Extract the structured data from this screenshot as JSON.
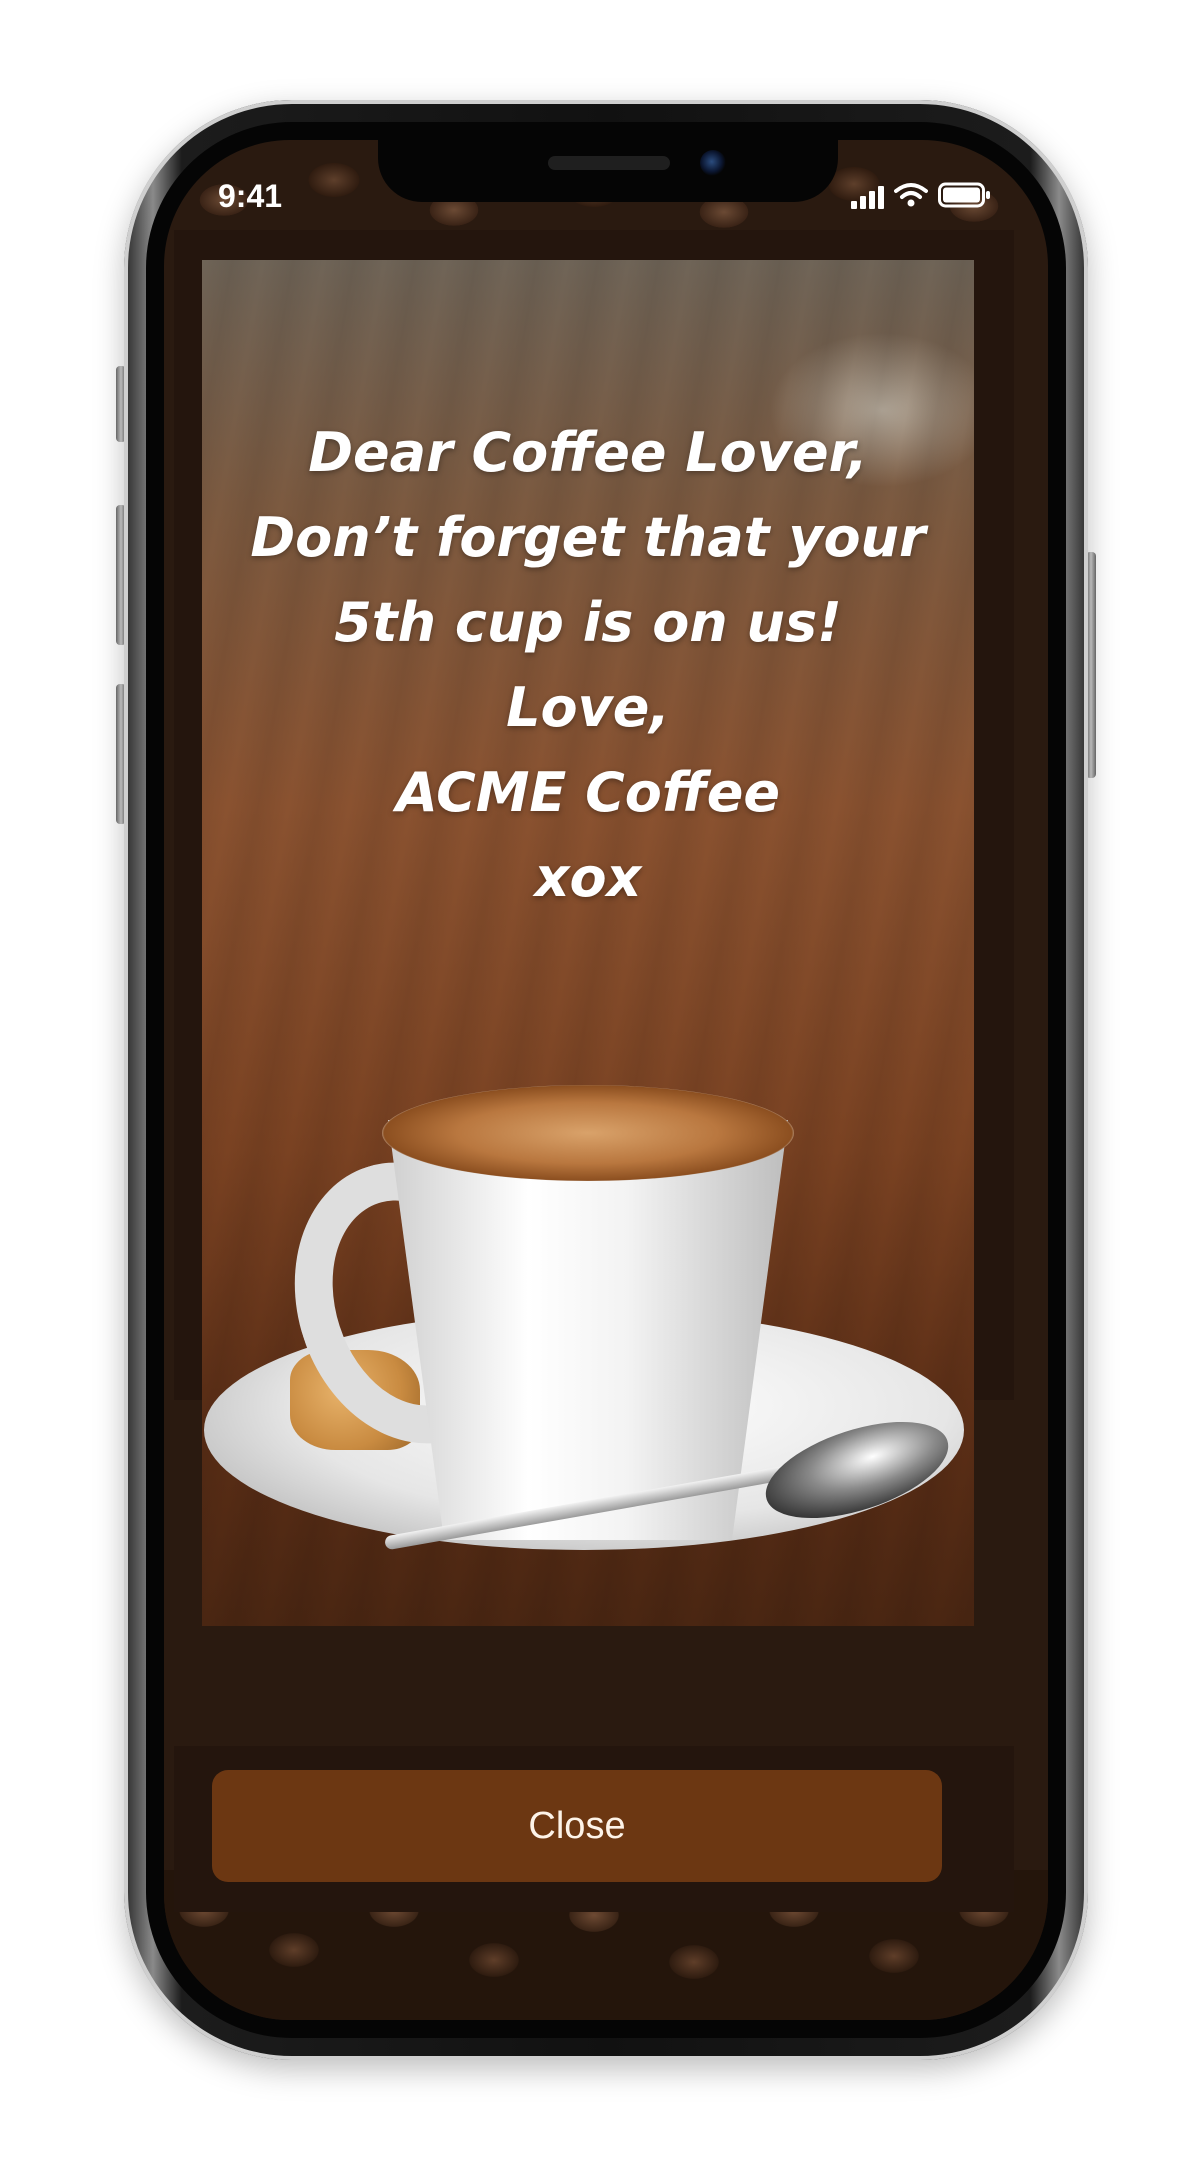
{
  "status_bar": {
    "time": "9:41",
    "icons": [
      "cellular-signal-icon",
      "wifi-icon",
      "battery-icon"
    ]
  },
  "notification": {
    "message_lines": [
      "Dear Coffee Lover,",
      "Don’t forget that your",
      "5th cup is on us!",
      "Love,",
      "ACME Coffee",
      "xox"
    ],
    "image": "coffee-cup-on-saucer-photo",
    "close_label": "Close"
  },
  "colors": {
    "modal_background": "#24150d",
    "button_background": "#6c3712",
    "button_text": "#fdf3e8",
    "message_text": "#ffffff"
  }
}
